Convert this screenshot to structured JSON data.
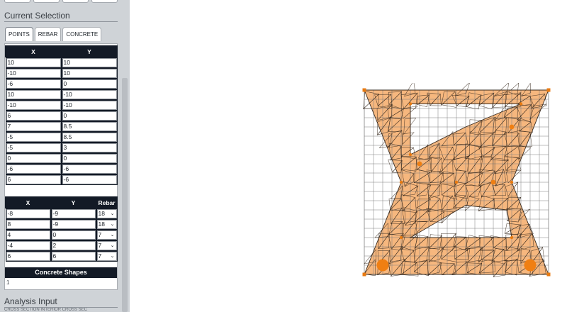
{
  "sidebar": {
    "current_selection": "Current Selection",
    "tabs": [
      {
        "label": "POINTS"
      },
      {
        "label": "REBAR"
      },
      {
        "label": "CONCRETE"
      }
    ],
    "points_table": {
      "headers": [
        "X",
        "Y"
      ],
      "rows": [
        [
          "10",
          "10"
        ],
        [
          "-10",
          "10"
        ],
        [
          "-6",
          "0"
        ],
        [
          "10",
          "-10"
        ],
        [
          "-10",
          "-10"
        ],
        [
          "6",
          "0"
        ],
        [
          "7",
          "8.5"
        ],
        [
          "-5",
          "8.5"
        ],
        [
          "-5",
          "3"
        ],
        [
          "0",
          "0"
        ],
        [
          "-6",
          "-6"
        ],
        [
          "6",
          "-6"
        ]
      ]
    },
    "rebar_table": {
      "headers": [
        "X",
        "Y",
        "Rebar"
      ],
      "rows": [
        [
          "-8",
          "-9",
          "18"
        ],
        [
          "8",
          "-9",
          "18"
        ],
        [
          "4",
          "0",
          "7"
        ],
        [
          "-4",
          "2",
          "7"
        ],
        [
          "6",
          "6",
          "7"
        ]
      ]
    },
    "concrete_shapes": {
      "label": "Concrete Shapes",
      "value": "1"
    },
    "analysis_input": "Analysis Input",
    "partial_labels": "CROSS SECTION            INTERIOR CROSS SEC"
  },
  "section": {
    "fill_color": "#f6b77e",
    "mesh_color": "#3a2c20",
    "grid_color": "#7f7f7f",
    "point_color": "#e87a10",
    "rebar_color": "#f07f12"
  }
}
